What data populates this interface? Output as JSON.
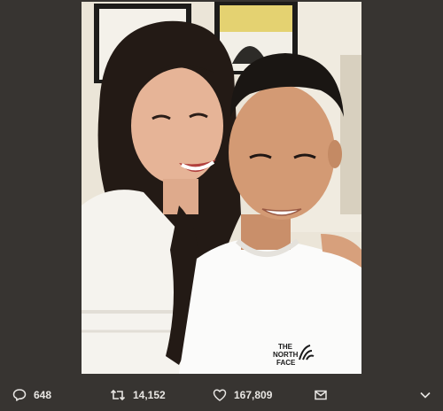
{
  "photo": {
    "subject": "selfie-photo",
    "shirt_logo_line1": "THE",
    "shirt_logo_line2": "NORTH",
    "shirt_logo_line3": "FACE"
  },
  "actions": {
    "reply_count": "648",
    "retweet_count": "14,152",
    "like_count": "167,809"
  },
  "icons": {
    "reply": "comment-bubble-icon",
    "retweet": "retweet-arrows-icon",
    "like": "heart-outline-icon",
    "dm": "envelope-icon",
    "more": "chevron-down-icon"
  },
  "colors": {
    "background": "#373431",
    "icon": "#e8e6e3"
  }
}
